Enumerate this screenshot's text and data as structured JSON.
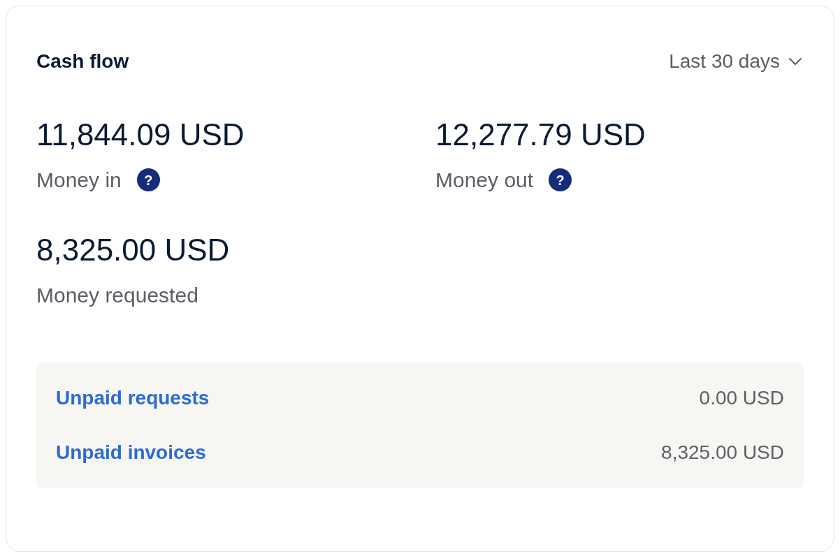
{
  "title": "Cash flow",
  "period": {
    "label": "Last 30 days"
  },
  "metrics": [
    {
      "amount": "11,844.09 USD",
      "label": "Money in",
      "hint": "?"
    },
    {
      "amount": "12,277.79 USD",
      "label": "Money out",
      "hint": "?"
    },
    {
      "amount": "8,325.00 USD",
      "label": "Money requested"
    }
  ],
  "unpaid": [
    {
      "label": "Unpaid requests",
      "value": "0.00 USD"
    },
    {
      "label": "Unpaid invoices",
      "value": "8,325.00 USD"
    }
  ]
}
